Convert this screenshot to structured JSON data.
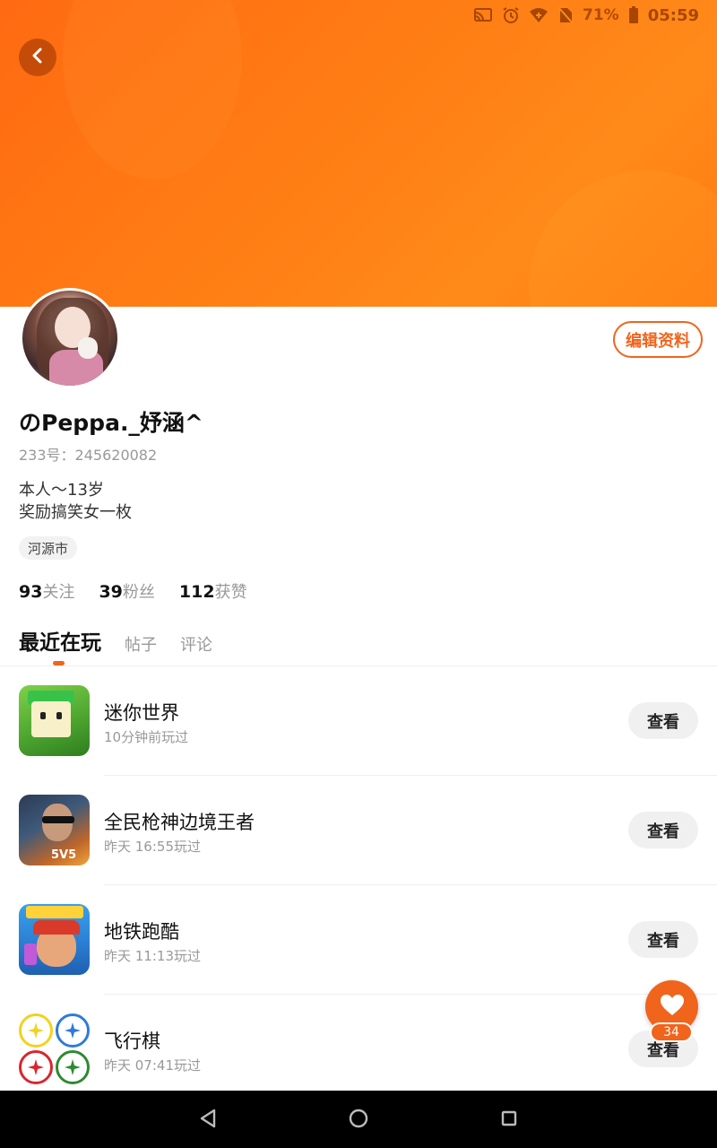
{
  "status_bar": {
    "battery_percent": "71%",
    "time": "05:59",
    "icons": [
      "cast-icon",
      "alarm-icon",
      "wifi-icon",
      "no-sim-icon",
      "battery-icon"
    ]
  },
  "header": {
    "back_icon": "chevron-left-icon",
    "banner_color": "#ff7514"
  },
  "profile": {
    "edit_label": "编辑资料",
    "username": "のPeppa._妤涵^",
    "uid": "233号：245620082",
    "bio_line1": "本人～13岁",
    "bio_line2": "奖励搞笑女一枚",
    "location": "河源市",
    "stats": {
      "following_count": "93",
      "following_label": "关注",
      "fans_count": "39",
      "fans_label": "粉丝",
      "likes_count": "112",
      "likes_label": "获赞"
    }
  },
  "tabs": [
    {
      "label": "最近在玩",
      "active": true
    },
    {
      "label": "帖子",
      "active": false
    },
    {
      "label": "评论",
      "active": false
    }
  ],
  "games": [
    {
      "title": "迷你世界",
      "time": "10分钟前玩过",
      "button": "查看"
    },
    {
      "title": "全民枪神边境王者",
      "time": "昨天 16:55玩过",
      "button": "查看",
      "icon_badge": "5V5"
    },
    {
      "title": "地铁跑酷",
      "time": "昨天 11:13玩过",
      "button": "查看"
    },
    {
      "title": "飞行棋",
      "time": "昨天 07:41玩过",
      "button": "查看"
    }
  ],
  "fab": {
    "icon": "heart-icon",
    "count": "34"
  },
  "nav_bar": {
    "icons": [
      "back-triangle-icon",
      "home-circle-icon",
      "recents-square-icon"
    ]
  },
  "colors": {
    "accent": "#f0641c",
    "muted_text": "#999999"
  }
}
